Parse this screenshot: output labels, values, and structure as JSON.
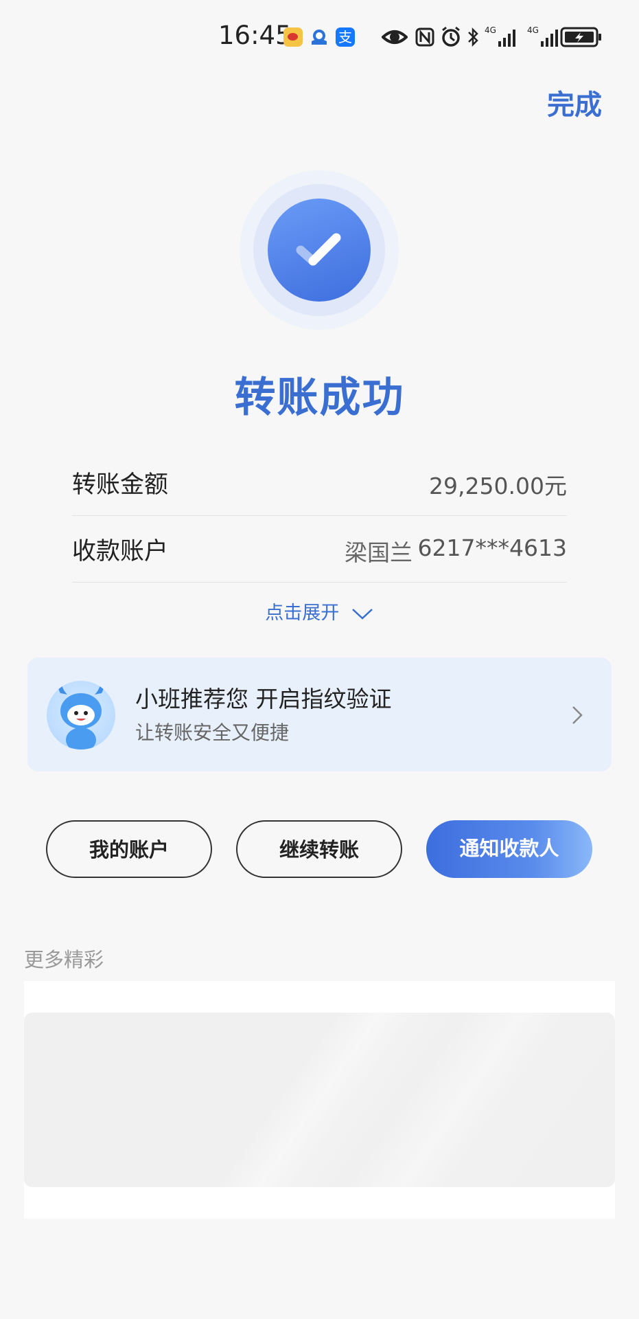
{
  "status_bar": {
    "time": "16:45",
    "alipay_glyph": "支",
    "icons": [
      "weibo-icon",
      "cloud-app-icon",
      "alipay-icon",
      "eye-icon",
      "nfc-icon",
      "alarm-icon",
      "bluetooth-icon",
      "signal-4g-icon",
      "signal-4g-icon",
      "battery-charging-icon"
    ]
  },
  "header": {
    "done_label": "完成"
  },
  "result": {
    "title": "转账成功",
    "icon": "check-icon",
    "accent_color": "#3a6fd1"
  },
  "details": {
    "amount_label": "转账金额",
    "amount_value": "29,250.00元",
    "account_label": "收款账户",
    "payee_name": "梁国兰",
    "account_number": "6217***4613"
  },
  "expand": {
    "label": "点击展开"
  },
  "promo": {
    "title": "小班推荐您 开启指纹验证",
    "subtitle": "让转账安全又便捷"
  },
  "actions": {
    "my_account": "我的账户",
    "continue_transfer": "继续转账",
    "notify_payee": "通知收款人"
  },
  "more": {
    "title": "更多精彩"
  }
}
